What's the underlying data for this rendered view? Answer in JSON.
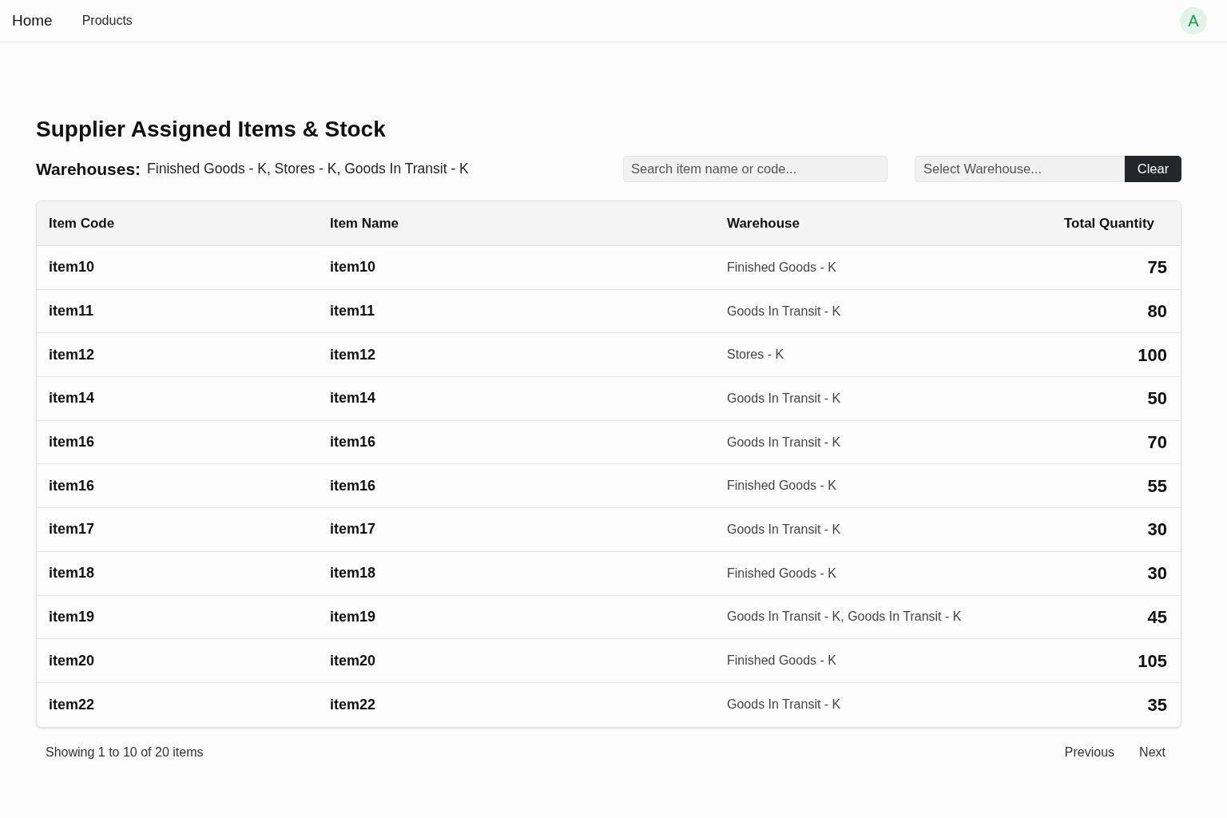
{
  "nav": {
    "links": [
      {
        "label": "Home",
        "selected": true
      },
      {
        "label": "Products",
        "selected": false
      }
    ],
    "avatar": "A"
  },
  "page": {
    "title": "Supplier Assigned Items & Stock",
    "warehouses_label": "Warehouses:",
    "warehouses_value": "Finished Goods - K, Stores - K, Goods In Transit - K"
  },
  "search": {
    "placeholder": "Search item name or code..."
  },
  "warehouse_select": {
    "placeholder": "Select Warehouse..."
  },
  "clear_button": "Clear",
  "table": {
    "columns": [
      "Item Code",
      "Item Name",
      "Warehouse",
      "Total Quantity"
    ],
    "rows": [
      [
        "item10",
        "item10",
        "Finished Goods - K",
        "75"
      ],
      [
        "item11",
        "item11",
        "Goods In Transit - K",
        "80"
      ],
      [
        "item12",
        "item12",
        "Stores - K",
        "100"
      ],
      [
        "item14",
        "item14",
        "Goods In Transit - K",
        "50"
      ],
      [
        "item16",
        "item16",
        "Goods In Transit - K",
        "70"
      ],
      [
        "item16",
        "item16",
        "Finished Goods - K",
        "55"
      ],
      [
        "item17",
        "item17",
        "Goods In Transit - K",
        "30"
      ],
      [
        "item18",
        "item18",
        "Finished Goods - K",
        "30"
      ],
      [
        "item19",
        "item19",
        "Goods In Transit - K, Goods In Transit - K",
        "45"
      ],
      [
        "item20",
        "item20",
        "Finished Goods - K",
        "105"
      ],
      [
        "item22",
        "item22",
        "Goods In Transit - K",
        "35"
      ]
    ]
  },
  "pagination": {
    "summary": "Showing 1 to 10 of 20 items",
    "previous": "Previous",
    "next": "Next"
  }
}
